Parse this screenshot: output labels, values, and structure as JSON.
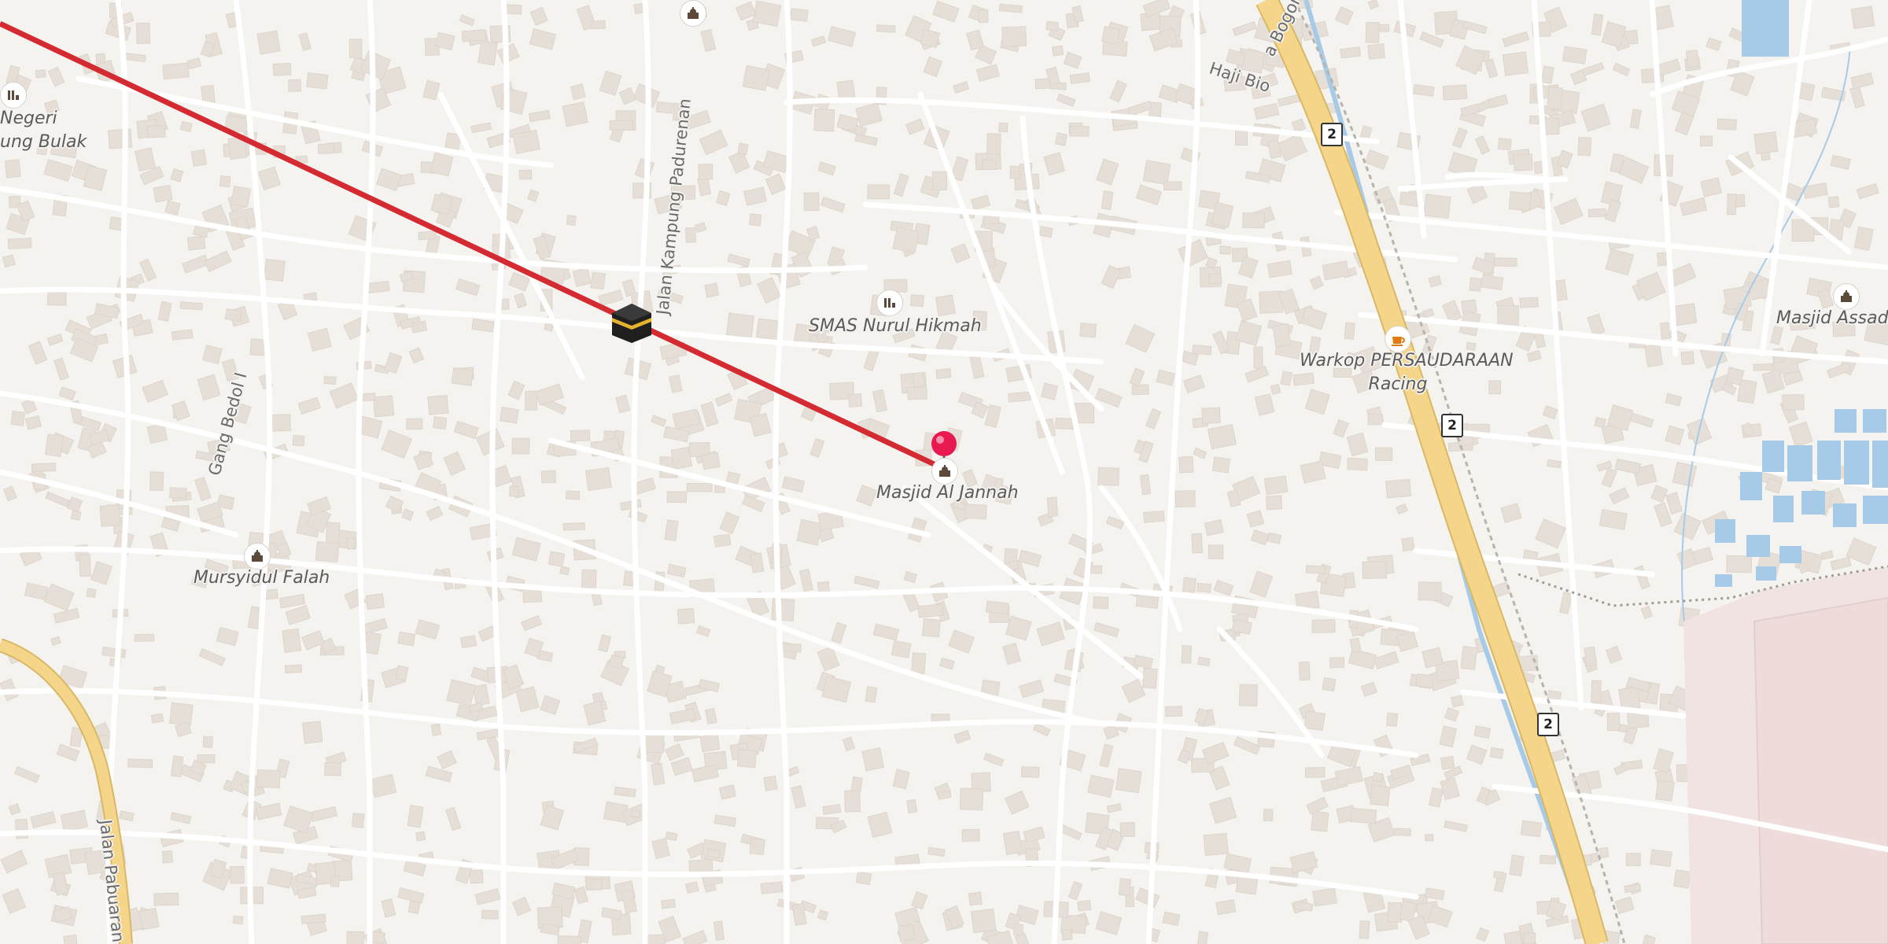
{
  "map": {
    "labels": {
      "school_top_left_line1": "Negeri",
      "school_top_left_line2": "ung Bulak",
      "school_center": "SMAS Nurul Hikmah",
      "mosque_destination": "Masjid Al Jannah",
      "mosque_left": "Mursyidul Falah",
      "cafe_line1": "Warkop PERSAUDARAAN",
      "cafe_line2": "Racing",
      "mosque_right": "Masjid Assadi"
    },
    "streets": {
      "padurenan": "Jalan Kampung Padurenan",
      "bedol": "Gang Bedol I",
      "haji_bio": "Haji Bio",
      "bogor": "a Bogor",
      "pabuaran": "Jalan Pabuaran"
    },
    "shields": {
      "top": "2",
      "middle": "2",
      "bottom": "2"
    },
    "colors": {
      "background": "#f5f3f0",
      "road": "#ffffff",
      "building": "#e6dfd8",
      "major_road": "#f4d58a",
      "qibla_line": "#d42a32",
      "water": "#a7cbe6",
      "pin": "#e8194f"
    },
    "icons": {
      "kaaba": "kaaba-icon",
      "destination_pin": "location-pin-icon",
      "mosque": "mosque-icon",
      "school": "school-icon",
      "cafe": "coffee-cup-icon"
    }
  }
}
